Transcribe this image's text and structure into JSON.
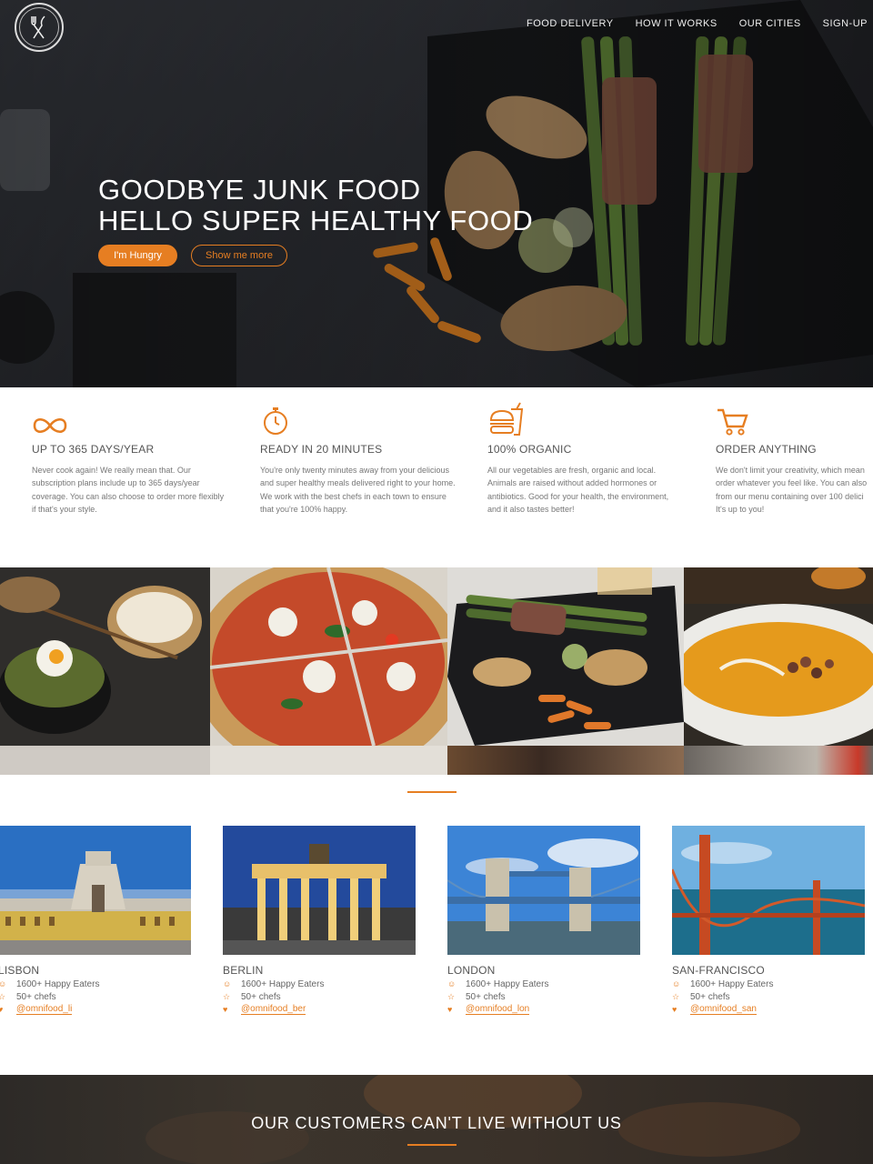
{
  "nav": {
    "items": [
      "Food delivery",
      "How it works",
      "Our cities",
      "Sign-up"
    ]
  },
  "hero": {
    "title_line1": "Goodbye junk food",
    "title_line2": "Hello super healthy food",
    "btn_primary": "I'm Hungry",
    "btn_secondary": "Show me more"
  },
  "features": [
    {
      "icon": "infinity-icon",
      "title": "Up to 365 days/year",
      "text": "Never cook again! We really mean that. Our subscription plans include up to 365 days/year coverage. You can also choose to order more flexibly if that's your style."
    },
    {
      "icon": "stopwatch-icon",
      "title": "Ready in 20 minutes",
      "text": "You're only twenty minutes away from your delicious and super healthy meals delivered right to your home. We work with the best chefs in each town to ensure that you're 100% happy."
    },
    {
      "icon": "burger-drink-icon",
      "title": "100% organic",
      "text": "All our vegetables are fresh, organic and local. Animals are raised without added hormones or antibiotics. Good for your health, the environment, and it also tastes better!"
    },
    {
      "icon": "cart-icon",
      "title": "Order anything",
      "lines": [
        "We don't limit your creativity, which mean",
        "order whatever you feel like. You can also",
        "from our menu containing over 100 delici",
        "It's up to you!"
      ]
    }
  ],
  "cities": [
    {
      "name": "Lisbon",
      "eaters": "1600+ Happy Eaters",
      "chefs": "50+ chefs",
      "twitter": "@omnifood_li"
    },
    {
      "name": "Berlin",
      "eaters": "1600+ Happy Eaters",
      "chefs": "50+ chefs",
      "twitter": "@omnifood_ber"
    },
    {
      "name": "London",
      "eaters": "1600+ Happy Eaters",
      "chefs": "50+ chefs",
      "twitter": "@omnifood_lon"
    },
    {
      "name": "San-Francisco",
      "eaters": "1600+ Happy Eaters",
      "chefs": "50+ chefs",
      "twitter": "@omnifood_san"
    }
  ],
  "testimonials": {
    "title": "Our customers can't live without us"
  },
  "colors": {
    "accent": "#e67e22"
  }
}
